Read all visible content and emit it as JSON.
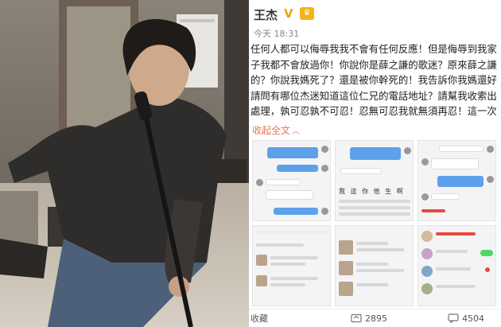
{
  "post": {
    "username": "王杰",
    "member_badge": "V",
    "timestamp": "今天 18:31",
    "lines": [
      "任何人都可以侮辱我我不會有任何反應！但是侮辱到我家",
      "子我都不會放過你！你說你是薛之謙的歌迷？原來薛之謙",
      "的？你說我媽死了？還是被你幹死的！我告訴你我媽還好",
      "請問有哪位杰迷知道這位仁兄的電話地址？請幫我收索出",
      "處理，孰可忍孰不可忍！忍無可忍我就無須再忍！這一次"
    ],
    "collapse_label": "收起全文",
    "thumb_text": "我 這 你 他 生 啊",
    "footer": {
      "favorite_label": "收藏",
      "repost_count": "2895",
      "comment_count": "4504"
    }
  },
  "colors": {
    "accent_orange": "#eb7350",
    "bubble_blue": "#5ea0ea",
    "verified_gold": "#f2a20c"
  }
}
